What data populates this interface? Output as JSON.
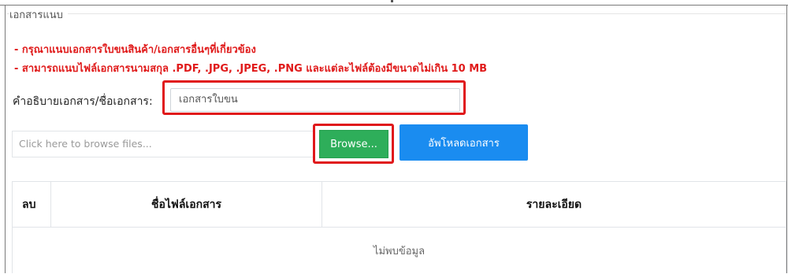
{
  "section": {
    "legend": "เอกสารแนบ",
    "notes": [
      "- กรุณาแนบเอกสารใบขนสินค้า/เอกสารอื่นๆที่เกี่ยวข้อง",
      "- สามารถแนบไฟล์เอกสารนามสกุล .PDF, .JPG, .JPEG, .PNG และแต่ละไฟล์ต้องมีขนาดไม่เกิน 10 MB"
    ]
  },
  "form": {
    "description_label": "คำอธิบายเอกสาร/ชื่อเอกสาร:",
    "description_value": "เอกสารใบขน",
    "file_placeholder": "Click here to browse files...",
    "browse_label": "Browse...",
    "upload_label": "อัพโหลดเอกสาร"
  },
  "table": {
    "headers": [
      "ลบ",
      "ชื่อไฟล์เอกสาร",
      "รายละเอียด"
    ],
    "empty_text": "ไม่พบข้อมูล"
  },
  "colors": {
    "note_red": "#e01b1b",
    "highlight_red": "#e0181b",
    "browse_green": "#2eae5a",
    "upload_blue": "#1a8cf0"
  }
}
